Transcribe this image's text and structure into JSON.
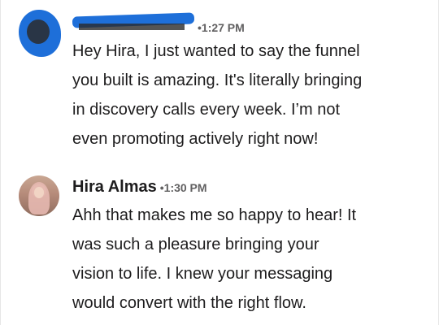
{
  "messages": [
    {
      "author": "",
      "time": "•1:27 PM",
      "lines": [
        "Hey Hira, I just wanted to say the funnel",
        "you built is amazing. It's literally bringing",
        "in discovery calls every week. I’m not",
        "even promoting actively right now!"
      ]
    },
    {
      "author": "Hira Almas",
      "time": "•1:30 PM",
      "lines": [
        "Ahh that makes me so happy to hear! It",
        "was such a pleasure bringing your",
        "vision to life. I knew your messaging",
        "would convert with the right flow."
      ]
    }
  ],
  "colors": {
    "redaction": "#1e6fd9",
    "text": "#1d1c1d",
    "muted": "#616061"
  },
  "icons": {
    "avatar_1": "redacted-avatar",
    "avatar_2": "profile-photo-avatar"
  }
}
